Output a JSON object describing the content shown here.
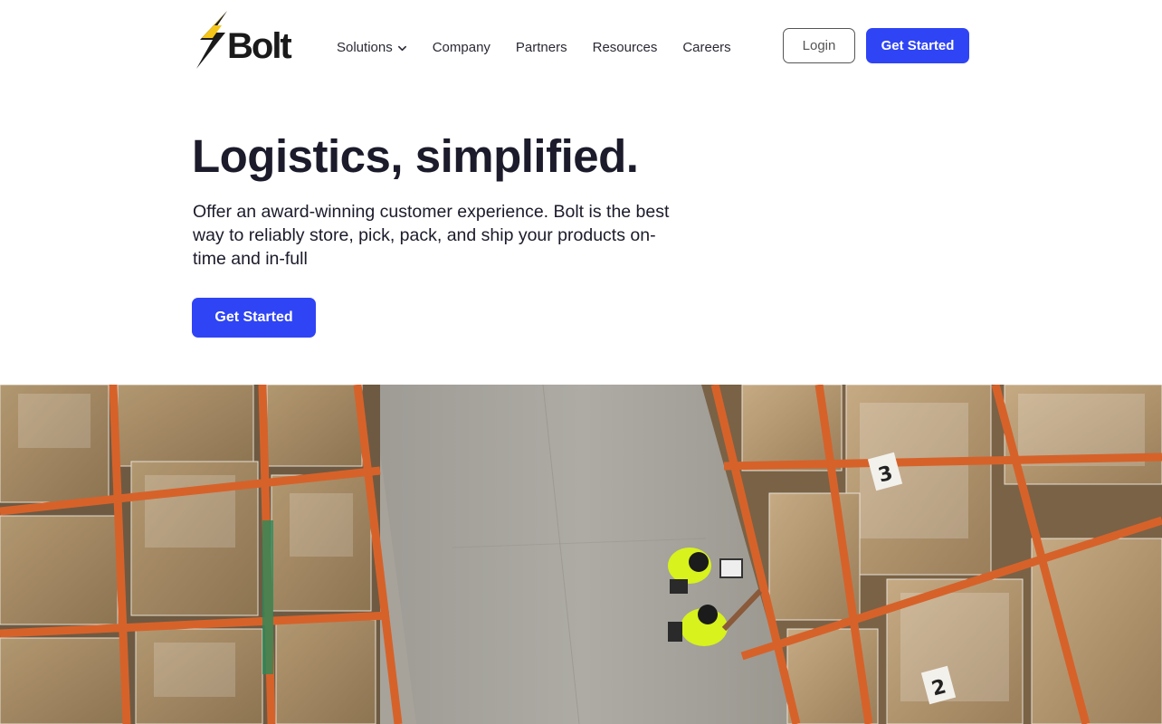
{
  "header": {
    "logo_text": "Bolt",
    "nav": [
      {
        "label": "Solutions",
        "has_dropdown": true
      },
      {
        "label": "Company"
      },
      {
        "label": "Partners"
      },
      {
        "label": "Resources"
      },
      {
        "label": "Careers"
      }
    ],
    "login_label": "Login",
    "get_started_label": "Get Started"
  },
  "hero": {
    "title": "Logistics, simplified.",
    "subtitle": "Offer an award-winning customer experience. Bolt is the best way to reliably store, pick, pack, and ship your products on-time and in-full",
    "cta_label": "Get Started"
  },
  "image": {
    "subject": "warehouse-aerial-workers",
    "box_labels": [
      "3",
      "2"
    ]
  },
  "colors": {
    "accent": "#2f44f5",
    "text": "#1b1b2b",
    "logo_yellow": "#f5c518",
    "rack_orange": "#d6622a",
    "vest": "#d7f21c"
  }
}
